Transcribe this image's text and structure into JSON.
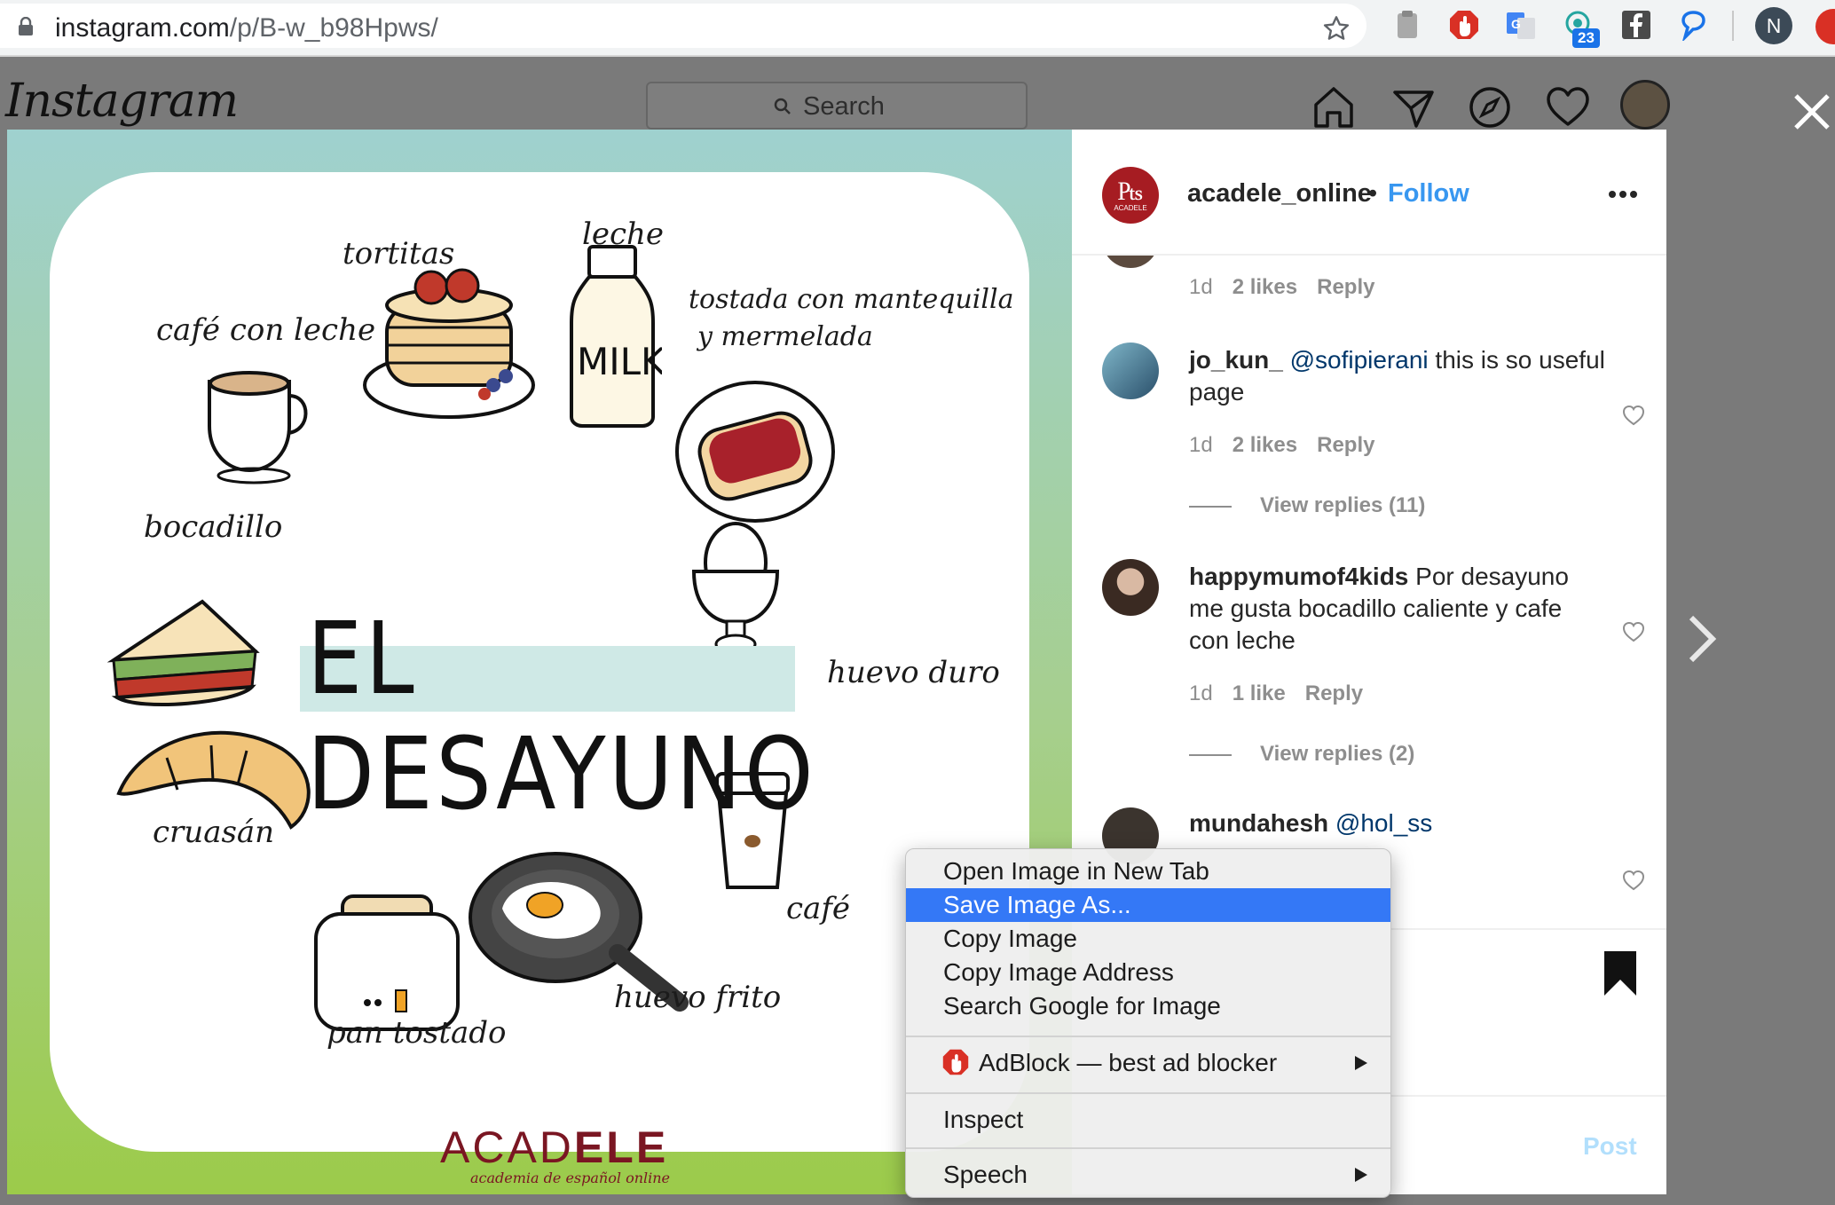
{
  "browser": {
    "url_host": "instagram.com",
    "url_path": "/p/B-w_b98Hpws/",
    "ext_badge": "23",
    "profile_initial": "N"
  },
  "header": {
    "logo": "Instagram",
    "search_placeholder": "Search"
  },
  "poster": {
    "title": "EL DESAYUNO",
    "labels": {
      "tortitas": "tortitas",
      "leche": "leche",
      "cafe_con_leche": "café con leche",
      "tostada_1": "tostada con mantequilla",
      "tostada_2": "y mermelada",
      "milk": "MILK",
      "bocadillo": "bocadillo",
      "huevo_duro": "huevo duro",
      "cruasan": "cruasán",
      "cafe": "café",
      "huevo_frito": "huevo frito",
      "pan_tostado": "pan tostado"
    },
    "brand_light": "ACAD",
    "brand_bold": "ELE",
    "brand_sub": "academia de español online"
  },
  "post": {
    "author": "acadele_online",
    "dot": "•",
    "follow_label": "Follow",
    "comments": [
      {
        "meta_time": "1d",
        "meta_likes": "2 likes",
        "meta_reply": "Reply"
      },
      {
        "user": "jo_kun_",
        "mention": "@sofipierani",
        "text": " this is so useful page",
        "meta_time": "1d",
        "meta_likes": "2 likes",
        "meta_reply": "Reply",
        "view_replies": "View replies (11)"
      },
      {
        "user": "happymumof4kids",
        "text": " Por desayuno me gusta bocadillo caliente y cafe con leche",
        "meta_time": "1d",
        "meta_likes": "1 like",
        "meta_reply": "Reply",
        "view_replies": "View replies (2)"
      },
      {
        "user": "mundahesh",
        "mention": "@hol_ss"
      }
    ],
    "post_button": "Post"
  },
  "context_menu": {
    "items": [
      {
        "label": "Open Image in New Tab"
      },
      {
        "label": "Save Image As..."
      },
      {
        "label": "Copy Image"
      },
      {
        "label": "Copy Image Address"
      },
      {
        "label": "Search Google for Image"
      },
      {
        "label": "AdBlock — best ad blocker"
      },
      {
        "label": "Inspect"
      },
      {
        "label": "Speech"
      }
    ]
  },
  "colors": {
    "follow_blue": "#3897f0",
    "selection_blue": "#3478f6",
    "brand_red": "#7a1622"
  }
}
